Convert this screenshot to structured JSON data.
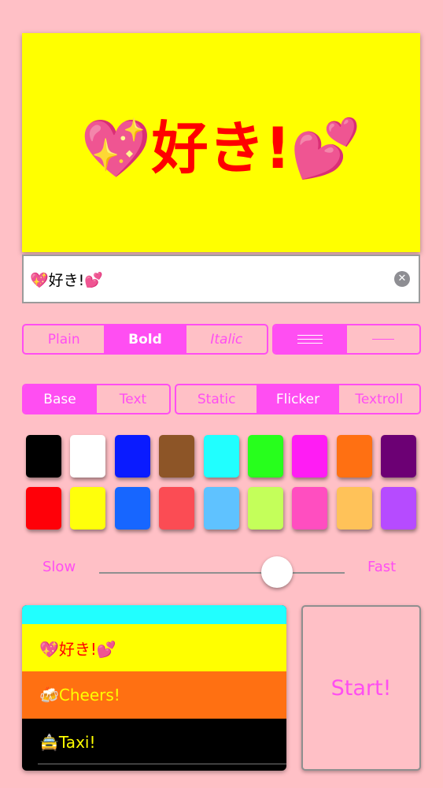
{
  "preview": {
    "text": "💖好き!💕",
    "background": "#ffff00",
    "text_color": "#ff0000"
  },
  "input": {
    "value": "💖好き!💕"
  },
  "font_style": {
    "options": [
      "Plain",
      "Bold",
      "Italic"
    ],
    "selected": "Bold"
  },
  "line_mode": {
    "options": [
      "lines-icon",
      "line-icon"
    ],
    "selected": "lines-icon"
  },
  "color_target": {
    "options": [
      "Base",
      "Text"
    ],
    "selected": "Base"
  },
  "animation": {
    "options": [
      "Static",
      "Flicker",
      "Textroll"
    ],
    "selected": "Flicker"
  },
  "palette": {
    "row1": [
      "#000000",
      "#ffffff",
      "#0a1bff",
      "#8d5527",
      "#20ffff",
      "#27ff1c",
      "#ff1cf4",
      "#ff7012",
      "#6c0074"
    ],
    "row2": [
      "#ff0008",
      "#ffff0b",
      "#1766ff",
      "#fb4c54",
      "#5fc2ff",
      "#c4ff5a",
      "#ff4ec0",
      "#ffc259",
      "#b64bff"
    ]
  },
  "speed": {
    "slow_label": "Slow",
    "fast_label": "Fast",
    "value": 0.72
  },
  "history": [
    {
      "text": "",
      "bg": "#21ffff",
      "fg": "#ffff00",
      "partial": true
    },
    {
      "text": "💖好き!💕",
      "bg": "#ffff00",
      "fg": "#ff0000"
    },
    {
      "text": "🍻Cheers!",
      "bg": "#ff7012",
      "fg": "#ffff00"
    },
    {
      "text": "🚖Taxi!",
      "bg": "#000000",
      "fg": "#ffff00"
    }
  ],
  "start_button": {
    "label": "Start!"
  }
}
